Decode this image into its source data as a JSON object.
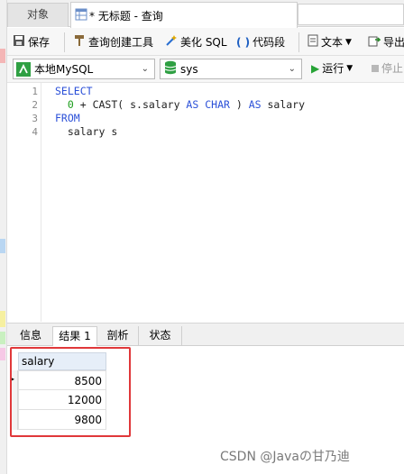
{
  "tabs": {
    "objects": "对象",
    "query": "* 无标题 - 查询"
  },
  "toolbar": {
    "save": "保存",
    "query_builder": "查询创建工具",
    "beautify": "美化 SQL",
    "code_snippet": "代码段",
    "text": "文本",
    "export": "导出"
  },
  "selectors": {
    "connection": "本地MySQL",
    "database": "sys"
  },
  "run": {
    "run_label": "运行",
    "stop_label": "停止"
  },
  "editor": {
    "line_numbers": [
      "1",
      "2",
      "3",
      "4"
    ],
    "tokens": {
      "select": "SELECT",
      "zero": "0",
      "plus_cast": " + CAST( s.salary ",
      "as1": "AS",
      "char": "CHAR",
      "close": " ) ",
      "as2": "AS",
      "alias": " salary",
      "from": "FROM",
      "table": "salary s"
    }
  },
  "bottom_tabs": {
    "info": "信息",
    "result": "结果 1",
    "profile": "剖析",
    "status": "状态"
  },
  "result": {
    "column": "salary",
    "rows": [
      "8500",
      "12000",
      "9800"
    ]
  },
  "watermark": "CSDN @Javaの甘乃迪",
  "colors": {
    "keyword": "#2b50d8",
    "number": "#1a9c1a",
    "highlight_box": "#e0383a"
  }
}
